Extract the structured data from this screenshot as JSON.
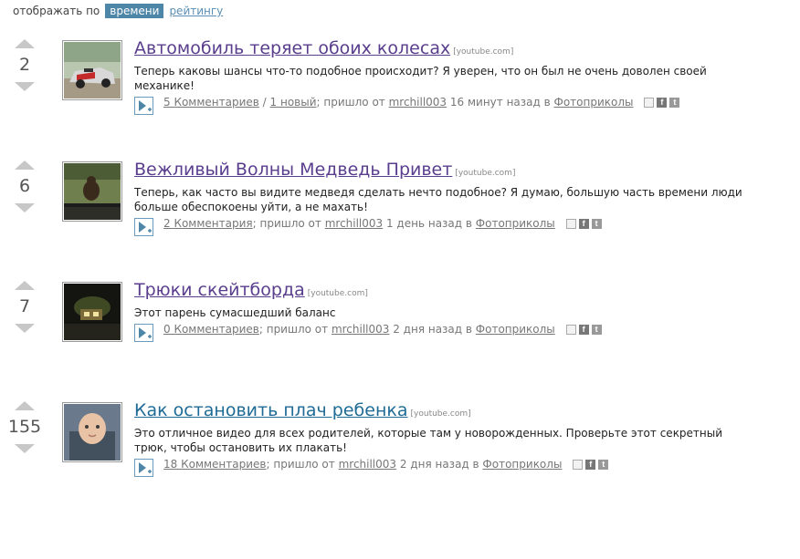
{
  "sort": {
    "label": "отображать по",
    "active": "времени",
    "other": "рейтингу"
  },
  "items": [
    {
      "score": "2",
      "title": "Автомобиль теряет обоих колесах",
      "source": "[youtube.com]",
      "desc": "Теперь каковы шансы что-то подобное происходит? Я уверен, что он был не очень доволен своей механике!",
      "comments": "5 Комментариев",
      "separator": " / ",
      "new_count": "1 новый",
      "posted_by": "; пришло от ",
      "user": "mrchill003",
      "time": " 16 минут назад в ",
      "category": "Фотоприколы"
    },
    {
      "score": "6",
      "title": "Вежливый Волны Медведь Привет",
      "source": "[youtube.com]",
      "desc": "Теперь, как часто вы видите медведя сделать нечто подобное? Я думаю, большую часть времени люди больше обеспокоены уйти, а не махать!",
      "comments": "2 Комментария",
      "posted_by": "; пришло от ",
      "user": "mrchill003",
      "time": " 1 день назад в ",
      "category": "Фотоприколы"
    },
    {
      "score": "7",
      "title": "Трюки скейтборда",
      "source": "[youtube.com]",
      "desc": "Этот парень сумасшедший баланс",
      "comments": "0 Комментариев",
      "posted_by": "; пришло от ",
      "user": "mrchill003",
      "time": " 2 дня назад в ",
      "category": "Фотоприколы"
    },
    {
      "score": "155",
      "title": "Как остановить плач ребенка",
      "source": "[youtube.com]",
      "desc": "Это отличное видео для всех родителей, которые там у новорожденных. Проверьте этот секретный трюк, чтобы остановить их плакать!",
      "comments": "18 Комментариев",
      "posted_by": "; пришло от ",
      "user": "mrchill003",
      "time": " 2 дня назад в ",
      "category": "Фотоприколы"
    }
  ],
  "icons": {
    "play": "play-add-icon",
    "save": "save-icon",
    "facebook": "facebook-icon",
    "twitter": "twitter-icon"
  },
  "colors": {
    "active_sort_bg": "#4e86a8",
    "title_visited": "#5a3e8e",
    "title_link": "#1f6b95"
  }
}
